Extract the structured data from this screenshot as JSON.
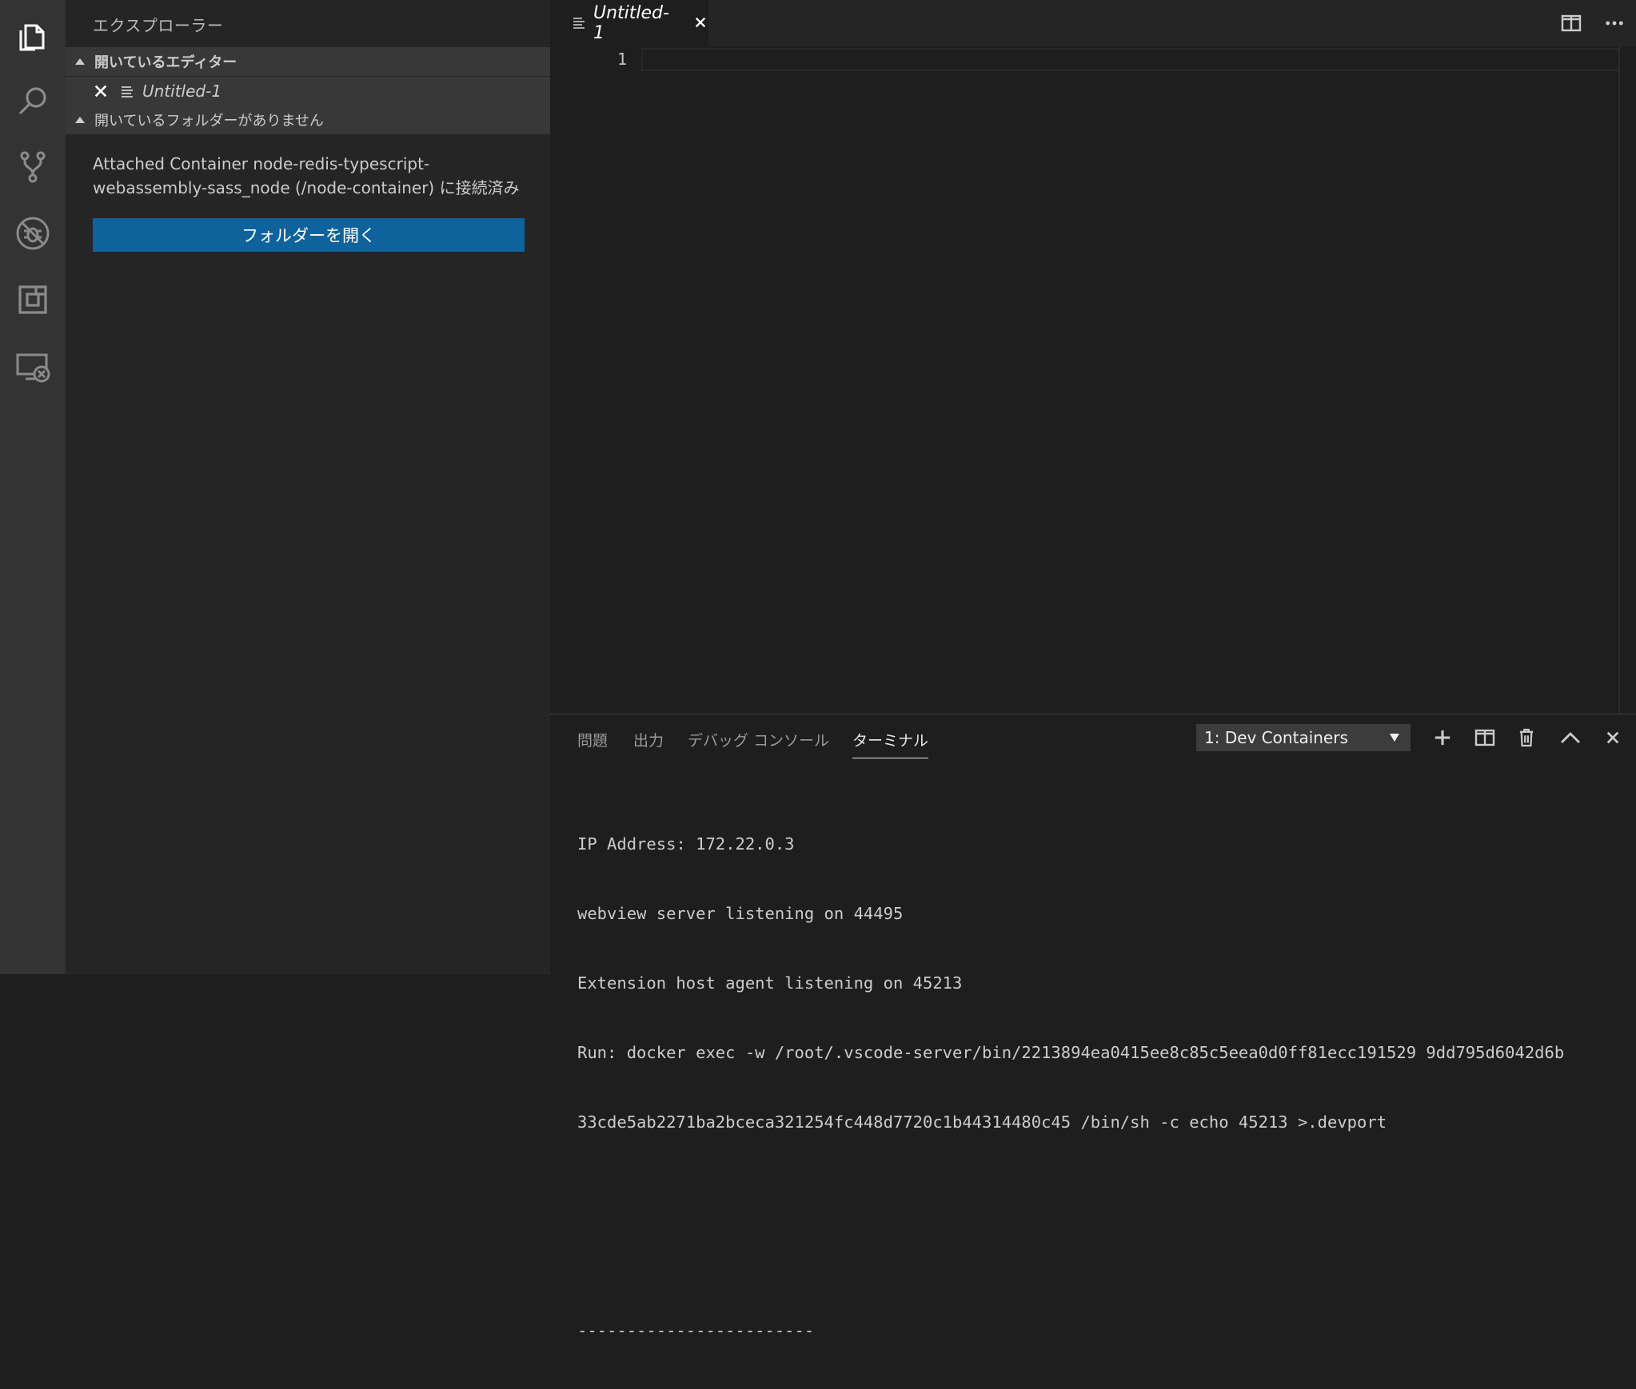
{
  "activity_bar": {
    "icons": [
      "files-icon",
      "search-icon",
      "source-control-icon",
      "debug-icon",
      "extensions-icon",
      "remote-explorer-icon"
    ]
  },
  "sidebar": {
    "title": "エクスプローラー",
    "open_editors": {
      "header": "開いているエディター",
      "items": [
        {
          "name": "Untitled-1"
        }
      ]
    },
    "no_folder": {
      "header": "開いているフォルダーがありません",
      "message_line1": "Attached Container node-redis-typescript-",
      "message_line2": "webassembly-sass_node (/node-container) に接続済み",
      "open_folder_button": "フォルダーを開く"
    }
  },
  "editor": {
    "tab": {
      "label": "Untitled-1"
    },
    "line_numbers": [
      "1"
    ]
  },
  "panel": {
    "tabs": [
      "問題",
      "出力",
      "デバッグ コンソール",
      "ターミナル"
    ],
    "active_tab": "ターミナル",
    "terminal_select": "1: Dev Containers",
    "terminal_lines": [
      "IP Address: 172.22.0.3",
      "webview server listening on 44495",
      "Extension host agent listening on 45213",
      "Run: docker exec -w /root/.vscode-server/bin/2213894ea0415ee8c85c5eea0d0ff81ecc191529 9dd795d6042d6b",
      "33cde5ab2271ba2bceca321254fc448d7720c1b44314480c45 /bin/sh -c echo 45213 >.devport",
      "",
      "",
      "------------------------"
    ]
  },
  "colors": {
    "activity_bar_bg": "#333333",
    "sidebar_bg": "#252526",
    "editor_bg": "#1e1e1e",
    "button_bg": "#0e639c"
  }
}
